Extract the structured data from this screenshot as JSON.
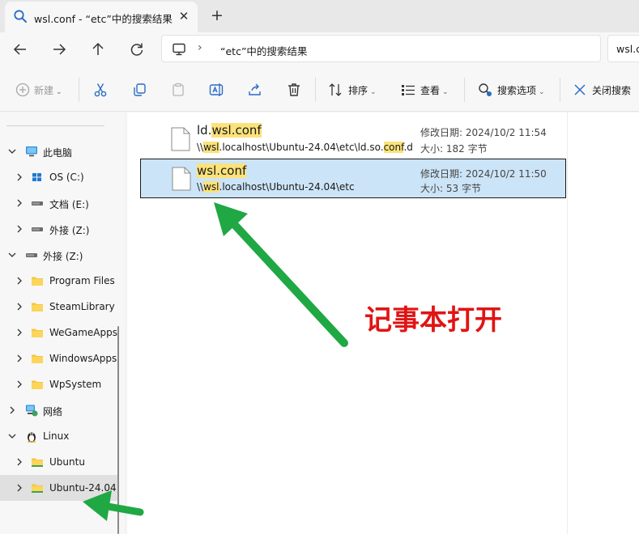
{
  "tab": {
    "title": "wsl.conf - “etc”中的搜索结果",
    "close": "✕",
    "new_tab": "+"
  },
  "address": {
    "separator": "›",
    "text": "“etc”中的搜索结果",
    "search_value": "wsl.conf"
  },
  "toolbar": {
    "new_label": "新建",
    "sort_label": "排序",
    "view_label": "查看",
    "search_options_label": "搜索选项",
    "close_search_label": "关闭搜索"
  },
  "sidebar": {
    "items": [
      {
        "label": "此电脑"
      },
      {
        "label": "OS (C:)"
      },
      {
        "label": "文档 (E:)"
      },
      {
        "label": "外接 (Z:)"
      },
      {
        "label": "外接 (Z:)"
      },
      {
        "label": "Program Files"
      },
      {
        "label": "SteamLibrary"
      },
      {
        "label": "WeGameApps"
      },
      {
        "label": "WindowsApps"
      },
      {
        "label": "WpSystem"
      },
      {
        "label": "网络"
      },
      {
        "label": "Linux"
      },
      {
        "label": "Ubuntu"
      },
      {
        "label": "Ubuntu-24.04"
      }
    ]
  },
  "results": [
    {
      "name_prefix": "ld.",
      "name_match": "wsl.conf",
      "path_1": "\\\\",
      "path_match_1": "wsl",
      "path_2": ".localhost\\Ubuntu-24.04\\etc\\ld.so.",
      "path_match_2": "conf",
      "path_3": ".d",
      "date": "修改日期: 2024/10/2 11:54",
      "size": "大小: 182 字节"
    },
    {
      "name_match": "wsl.conf",
      "path_1": "\\\\",
      "path_match_1": "wsl",
      "path_2": ".localhost\\Ubuntu-24.04\\etc",
      "date": "修改日期: 2024/10/2 11:50",
      "size": "大小: 53 字节"
    }
  ],
  "annotation": {
    "text": "记事本打开",
    "color": "#e11414",
    "arrow_color": "#1fa843"
  },
  "colors": {
    "selection": "#cce4f7",
    "highlight": "#fbe27a",
    "folder": "#f3c746"
  }
}
